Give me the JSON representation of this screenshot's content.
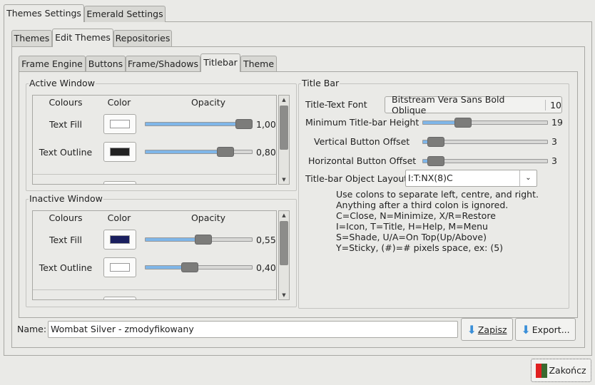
{
  "outer_tabs": [
    "Themes Settings",
    "Emerald Settings"
  ],
  "sub_tabs": [
    "Themes",
    "Edit Themes",
    "Repositories"
  ],
  "edit_tabs": [
    "Frame Engine",
    "Buttons",
    "Frame/Shadows",
    "Titlebar",
    "Theme"
  ],
  "active_window": {
    "title": "Active Window",
    "headers": [
      "Colours",
      "Color",
      "Opacity"
    ],
    "rows": [
      {
        "label": "Text Fill",
        "color": "#ffffff",
        "opacity": 1.0,
        "opacity_text": "1,00"
      },
      {
        "label": "Text Outline",
        "color": "#222222",
        "opacity": 0.8,
        "opacity_text": "0,80"
      }
    ]
  },
  "inactive_window": {
    "title": "Inactive Window",
    "headers": [
      "Colours",
      "Color",
      "Opacity"
    ],
    "rows": [
      {
        "label": "Text Fill",
        "color": "#1a1f5e",
        "opacity": 0.55,
        "opacity_text": "0,55"
      },
      {
        "label": "Text Outline",
        "color": "#ffffff",
        "opacity": 0.4,
        "opacity_text": "0,40"
      }
    ]
  },
  "title_bar": {
    "title": "Title Bar",
    "font_label": "Title-Text Font",
    "font_name": "Bitstream Vera Sans Bold Oblique",
    "font_size": "10",
    "sliders": [
      {
        "label": "Minimum Title-bar Height",
        "value": "19",
        "fraction": 0.25
      },
      {
        "label": "Vertical Button Offset",
        "value": "3",
        "fraction": 0.035
      },
      {
        "label": "Horizontal Button Offset",
        "value": "3",
        "fraction": 0.035
      }
    ],
    "layout_label": "Title-bar Object Layout",
    "layout_value": "I:T:NX(8)C",
    "help": [
      "Use colons to separate left, centre, and right.",
      "Anything after a third colon is ignored.",
      "C=Close, N=Minimize, X/R=Restore",
      "I=Icon, T=Title, H=Help, M=Menu",
      "S=Shade, U/A=On Top(Up/Above)",
      "Y=Sticky, (#)=# pixels space, ex: (5)"
    ]
  },
  "name_label": "Name:",
  "name_value": "Wombat Silver - zmodyfikowany",
  "save_label": "Zapisz",
  "export_label": "Export...",
  "quit_label": "Zakończ"
}
